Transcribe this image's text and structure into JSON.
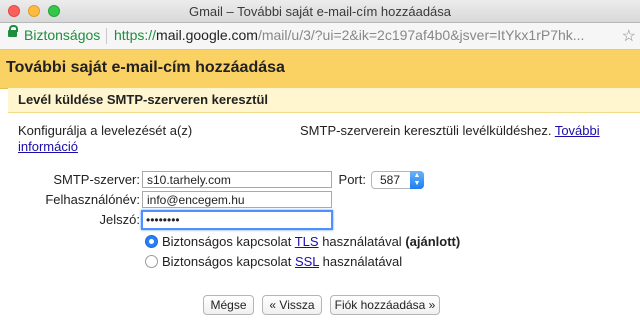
{
  "window": {
    "title": "Gmail – További saját e-mail-cím hozzáadása"
  },
  "address_bar": {
    "security_label": "Biztonságos",
    "url_scheme": "https://",
    "url_host": "mail.google.com",
    "url_rest": "/mail/u/3/?ui=2&ik=2c197af4b0&jsver=ItYkx1rP7hk..."
  },
  "dialog": {
    "title": "További saját e-mail-cím hozzáadása",
    "section_title": "Levél küldése SMTP-szerveren keresztül",
    "description_left": "Konfigurálja a levelezését a(z)",
    "description_right": "SMTP-szerverein keresztüli levélküldéshez.",
    "more_info_link_line1": "További",
    "more_info_link_line2": "információ"
  },
  "form": {
    "smtp_label": "SMTP-szerver:",
    "smtp_value": "s10.tarhely.com",
    "port_label": "Port:",
    "port_value": "587",
    "username_label": "Felhasználónév:",
    "username_value": "info@encegem.hu",
    "password_label": "Jelszó:",
    "password_value": "••••••••"
  },
  "radios": {
    "tls": {
      "prefix": "Biztonságos kapcsolat ",
      "link": "TLS",
      "suffix": " használatával ",
      "note": "(ajánlott)",
      "selected": true
    },
    "ssl": {
      "prefix": "Biztonságos kapcsolat ",
      "link": "SSL",
      "suffix": " használatával",
      "selected": false
    }
  },
  "buttons": {
    "cancel": "Mégse",
    "back": "« Vissza",
    "add_account": "Fiók hozzáadása »"
  },
  "icons": {
    "lock": "lock-icon",
    "star": "star-icon",
    "select_arrows": "select-arrows-icon"
  },
  "colors": {
    "header_bg": "#fad163",
    "subheader_bg": "#fff6cf",
    "secure_green": "#1e8e3e",
    "link_blue": "#1a0dab",
    "focus_blue": "#4d90fe"
  }
}
